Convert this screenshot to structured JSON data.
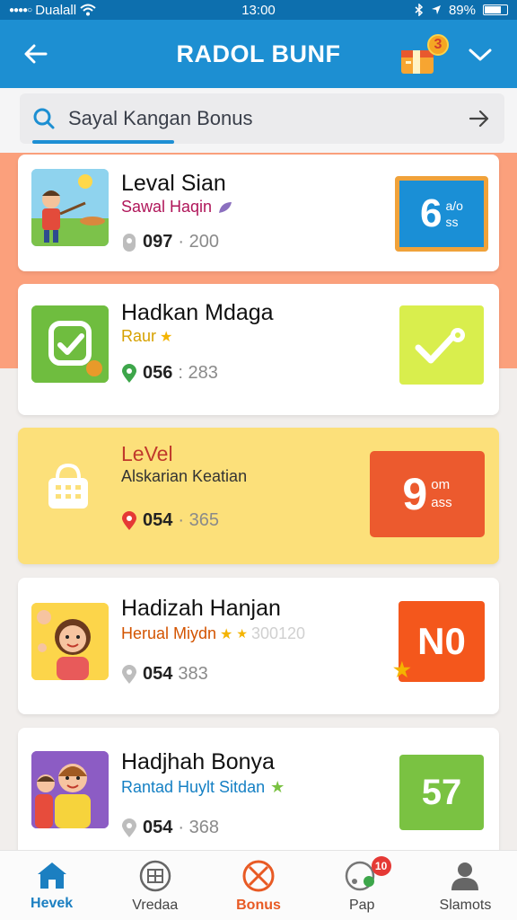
{
  "status_bar": {
    "carrier": "Dualall",
    "time": "13:00",
    "battery": "89%"
  },
  "header": {
    "title": "RADOL BUNF",
    "gift_badge": "3"
  },
  "search": {
    "text": "Sayal Kangan Bonus"
  },
  "cards": [
    {
      "title": "Leval Sian",
      "subtitle": "Sawal Haqin",
      "count": "097",
      "points": "· 200",
      "badge_main": "6",
      "badge_top": "a/o",
      "badge_bottom": "ss",
      "badge_color": "#1a8fd6"
    },
    {
      "title": "Hadkan Mdaga",
      "subtitle": "Raur",
      "count": "056",
      "points": ": 283",
      "badge_main": "",
      "badge_top": "",
      "badge_bottom": "",
      "badge_color": "#d9ee4d"
    },
    {
      "title": "LeVel",
      "subtitle": "Alskarian Keatian",
      "count": "054",
      "points": "· 365",
      "badge_main": "9",
      "badge_top": "om",
      "badge_bottom": "ass",
      "badge_color": "#ec5a2e"
    },
    {
      "title": "Hadizah Hanjan",
      "subtitle": "Herual Miydn",
      "extra": "300120",
      "count": "054",
      "points": "383",
      "badge_main": "N0",
      "badge_color": "#f4571c"
    },
    {
      "title": "Hadjhah Bonya",
      "subtitle": "Rantad Huylt Sitdan",
      "count": "054",
      "points": "· 368",
      "badge_main": "57",
      "badge_color": "#7ac242"
    }
  ],
  "bottom_nav": [
    {
      "label": "Hevek",
      "icon": "home-icon",
      "active": true
    },
    {
      "label": "Vredaa",
      "icon": "grid-icon"
    },
    {
      "label": "Bonus",
      "icon": "bonus-icon",
      "active": true
    },
    {
      "label": "Pap",
      "icon": "chat-icon",
      "notification": "10"
    },
    {
      "label": "Slamots",
      "icon": "profile-icon"
    }
  ],
  "colors": {
    "primary": "#1d8fd2",
    "accent_orange": "#fba07c",
    "highlight_card": "#fce07a"
  }
}
